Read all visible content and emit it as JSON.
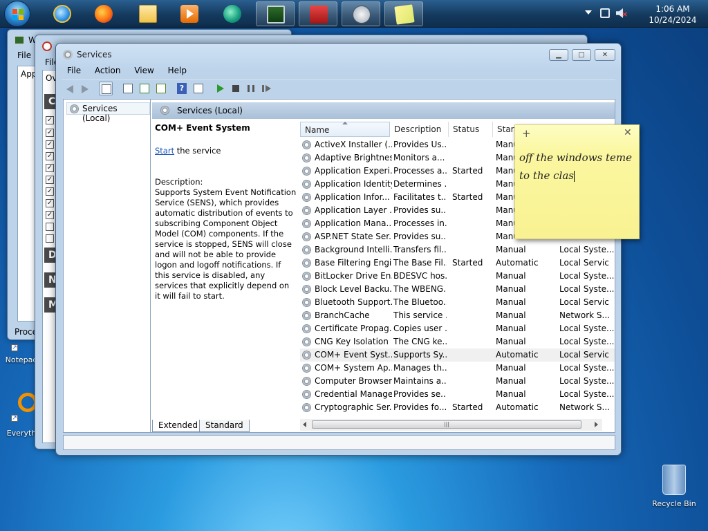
{
  "taskbar": {
    "clock_time": "1:06 AM",
    "clock_date": "10/24/2024",
    "icons": [
      "windows-start-icon",
      "internet-explorer-icon",
      "firefox-icon",
      "folder-icon",
      "media-player-icon",
      "media-center-icon",
      "monitor-icon",
      "toolbox-icon",
      "gauge-icon",
      "sticky-notes-icon"
    ]
  },
  "desktop": {
    "notepad_label": "Notepad",
    "everything_label": "Everyth",
    "recycle_bin_label": "Recycle Bin"
  },
  "bg_windows": {
    "win1_title": "W",
    "win1_menu": "File",
    "win1_tab": "App",
    "win1_footer": "Proce",
    "win2_menu": "File",
    "win2_tab": "Ov",
    "dark_tabs": [
      "CP",
      "Di",
      "Ne",
      "Me"
    ]
  },
  "services_window": {
    "title": "Services",
    "menu": [
      "File",
      "Action",
      "View",
      "Help"
    ],
    "tree_item": "Services (Local)",
    "pane_header": "Services (Local)",
    "selected_service": "COM+ Event System",
    "start_link": "Start",
    "start_suffix": " the service",
    "description_label": "Description:",
    "description": "Supports System Event Notification Service (SENS), which provides automatic distribution of events to subscribing Component Object Model (COM) components. If the service is stopped, SENS will close and will not be able to provide logon and logoff notifications. If this service is disabled, any services that explicitly depend on it will fail to start.",
    "columns": [
      "Name",
      "Description",
      "Status",
      "Startu"
    ],
    "rows": [
      {
        "name": "ActiveX Installer (...",
        "desc": "Provides Us...",
        "status": "",
        "start": "Manu",
        "logon": ""
      },
      {
        "name": "Adaptive Brightness",
        "desc": "Monitors a...",
        "status": "",
        "start": "Manu",
        "logon": ""
      },
      {
        "name": "Application Experi...",
        "desc": "Processes a...",
        "status": "Started",
        "start": "Manu",
        "logon": ""
      },
      {
        "name": "Application Identity",
        "desc": "Determines ...",
        "status": "",
        "start": "Manu",
        "logon": ""
      },
      {
        "name": "Application Infor...",
        "desc": "Facilitates t...",
        "status": "Started",
        "start": "Manu",
        "logon": ""
      },
      {
        "name": "Application Layer ...",
        "desc": "Provides su...",
        "status": "",
        "start": "Manu",
        "logon": ""
      },
      {
        "name": "Application Mana...",
        "desc": "Processes in...",
        "status": "",
        "start": "Manu",
        "logon": ""
      },
      {
        "name": "ASP.NET State Ser...",
        "desc": "Provides su...",
        "status": "",
        "start": "Manu",
        "logon": ""
      },
      {
        "name": "Background Intelli...",
        "desc": "Transfers fil...",
        "status": "",
        "start": "Manual",
        "logon": "Local Syste..."
      },
      {
        "name": "Base Filtering Engi...",
        "desc": "The Base Fil...",
        "status": "Started",
        "start": "Automatic",
        "logon": "Local Servic"
      },
      {
        "name": "BitLocker Drive En...",
        "desc": "BDESVC hos...",
        "status": "",
        "start": "Manual",
        "logon": "Local Syste..."
      },
      {
        "name": "Block Level Backu...",
        "desc": "The WBENG...",
        "status": "",
        "start": "Manual",
        "logon": "Local Syste..."
      },
      {
        "name": "Bluetooth Support...",
        "desc": "The Bluetoo...",
        "status": "",
        "start": "Manual",
        "logon": "Local Servic"
      },
      {
        "name": "BranchCache",
        "desc": "This service ...",
        "status": "",
        "start": "Manual",
        "logon": "Network S..."
      },
      {
        "name": "Certificate Propag...",
        "desc": "Copies user ...",
        "status": "",
        "start": "Manual",
        "logon": "Local Syste..."
      },
      {
        "name": "CNG Key Isolation",
        "desc": "The CNG ke...",
        "status": "",
        "start": "Manual",
        "logon": "Local Syste..."
      },
      {
        "name": "COM+ Event Syst...",
        "desc": "Supports Sy...",
        "status": "",
        "start": "Automatic",
        "logon": "Local Servic"
      },
      {
        "name": "COM+ System Ap...",
        "desc": "Manages th...",
        "status": "",
        "start": "Manual",
        "logon": "Local Syste..."
      },
      {
        "name": "Computer Browser",
        "desc": "Maintains a...",
        "status": "",
        "start": "Manual",
        "logon": "Local Syste..."
      },
      {
        "name": "Credential Manager",
        "desc": "Provides se...",
        "status": "",
        "start": "Manual",
        "logon": "Local Syste..."
      },
      {
        "name": "Cryptographic Ser...",
        "desc": "Provides fo...",
        "status": "Started",
        "start": "Automatic",
        "logon": "Network S..."
      }
    ],
    "selected_row_index": 16,
    "tabs": [
      "Extended",
      "Standard"
    ]
  },
  "sticky_note": {
    "line1": "off the windows teme",
    "line2": "to the clas"
  }
}
